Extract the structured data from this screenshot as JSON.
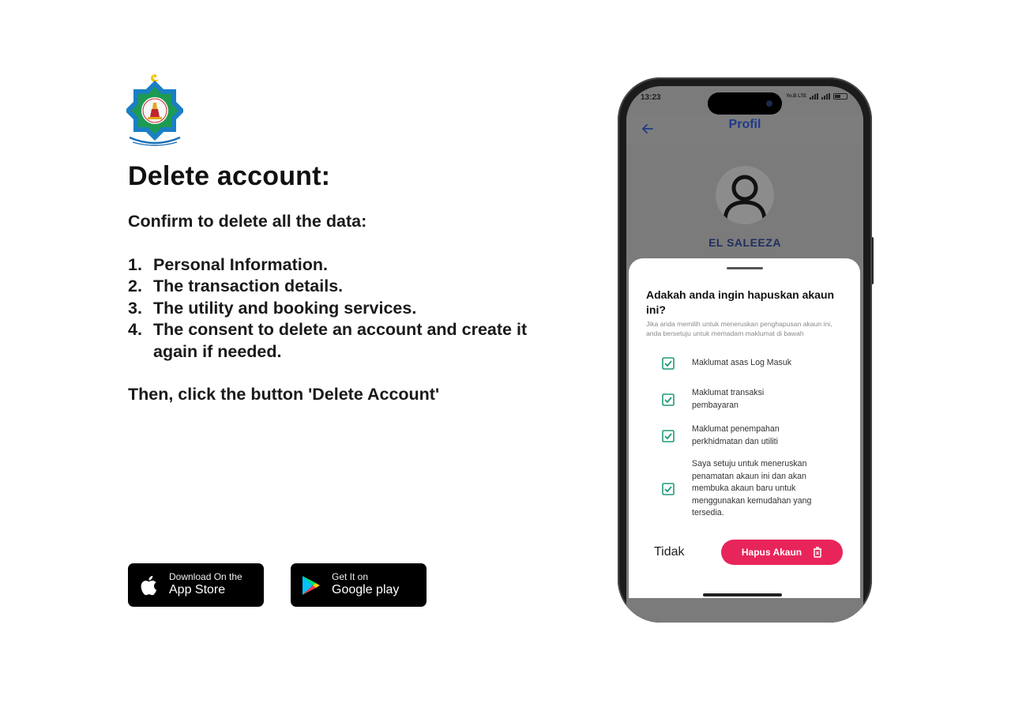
{
  "page": {
    "title": "Delete account:",
    "intro": "Confirm to delete all the data:",
    "items": [
      {
        "num": "1.",
        "text": "Personal Information."
      },
      {
        "num": "2.",
        "text": "The transaction details."
      },
      {
        "num": "3.",
        "text": "The utility and booking services."
      },
      {
        "num": "4.",
        "text": "The consent to delete an account and create it again if needed."
      }
    ],
    "final": "Then, click the button 'Delete Account'"
  },
  "stores": {
    "apple": {
      "small": "Download On the",
      "big": "App Store",
      "icon": "apple-icon"
    },
    "google": {
      "small": "Get It on",
      "big": "Google play",
      "icon": "google-play-icon"
    }
  },
  "phone": {
    "status_time": "13:23",
    "status_label": "Yo.B LTE",
    "app_title": "Profil",
    "username": "EL SALEEZA",
    "sheet": {
      "title": "Adakah anda ingin hapuskan akaun ini?",
      "desc": "Jika anda memilih untuk meneruskan penghapusan akaun ini, anda bersetuju untuk memadam maklumat di bawah",
      "checks": [
        {
          "label": "Maklumat asas Log Masuk",
          "checked": true
        },
        {
          "label": "Maklumat transaksi pembayaran",
          "checked": true
        },
        {
          "label": "Maklumat penempahan perkhidmatan dan utiliti",
          "checked": true
        },
        {
          "label": "Saya setuju untuk meneruskan penamatan akaun ini dan akan membuka akaun baru untuk menggunakan kemudahan yang tersedia.",
          "checked": true
        }
      ],
      "cancel": "Tidak",
      "confirm": "Hapus Akaun"
    }
  },
  "colors": {
    "accent": "#e8255a",
    "header_blue": "#1f3a8a",
    "check_green": "#1e9a7a"
  }
}
